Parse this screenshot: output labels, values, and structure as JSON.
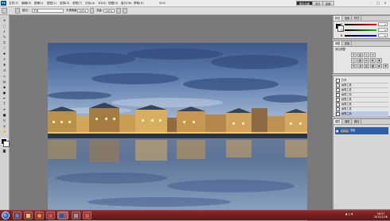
{
  "app": {
    "logo": "Ps"
  },
  "menubar": {
    "items": [
      "文件(F)",
      "编辑(E)",
      "图像(I)",
      "图层(L)",
      "选择(S)",
      "滤镜(T)",
      "分析(A)",
      "3D(D)",
      "视图(V)",
      "窗口(W)",
      "帮助(H)"
    ],
    "zoom": "50%",
    "workspaces": [
      "基本功能",
      "设计",
      "绘画"
    ],
    "window_controls": [
      "-",
      "□",
      "×"
    ]
  },
  "options_bar": {
    "mode_label": "模式:",
    "mode_value": "正常",
    "opacity_label": "不透明度:",
    "opacity_value": "100%",
    "flow_label": "流量:",
    "flow_value": "100%"
  },
  "tools": [
    "move-icon",
    "marquee-icon",
    "lasso-icon",
    "quick-select-icon",
    "crop-icon",
    "eyedropper-icon",
    "healing-icon",
    "brush-icon",
    "stamp-icon",
    "history-brush-icon",
    "eraser-icon",
    "gradient-icon",
    "blur-icon",
    "dodge-icon",
    "pen-icon",
    "type-icon",
    "path-select-icon",
    "shape-icon",
    "3d-rotate-icon",
    "3d-orbit-icon",
    "hand-icon",
    "zoom-icon"
  ],
  "panels": {
    "color": {
      "tabs": [
        "颜色",
        "色板",
        "样式"
      ],
      "channels": [
        {
          "name": "R",
          "value": "0",
          "color": "#ff0000"
        },
        {
          "name": "G",
          "value": "0",
          "color": "#00a000"
        },
        {
          "name": "B",
          "value": "0",
          "color": "#0000ff"
        }
      ]
    },
    "adjustments": {
      "tabs": [
        "调整",
        "蒙版"
      ],
      "title": "添加调整",
      "icons": [
        "brightness-icon",
        "levels-icon",
        "curves-icon",
        "exposure-icon",
        "vibrance-icon",
        "hue-icon",
        "balance-icon",
        "bw-icon",
        "photo-filter-icon",
        "mixer-icon",
        "invert-icon",
        "posterize-icon",
        "threshold-icon",
        "gradient-map-icon",
        "selective-color-icon"
      ]
    },
    "history": {
      "items": [
        "打开",
        "画笔工具",
        "画笔工具",
        "画笔工具",
        "画笔工具",
        "画笔工具",
        "画笔工具",
        "画笔工具"
      ]
    },
    "layers": {
      "tabs": [
        "图层",
        "通道",
        "路径"
      ],
      "layer_name": "背景"
    }
  },
  "taskbar": {
    "time": "18:57",
    "date": "2015/2/26"
  }
}
